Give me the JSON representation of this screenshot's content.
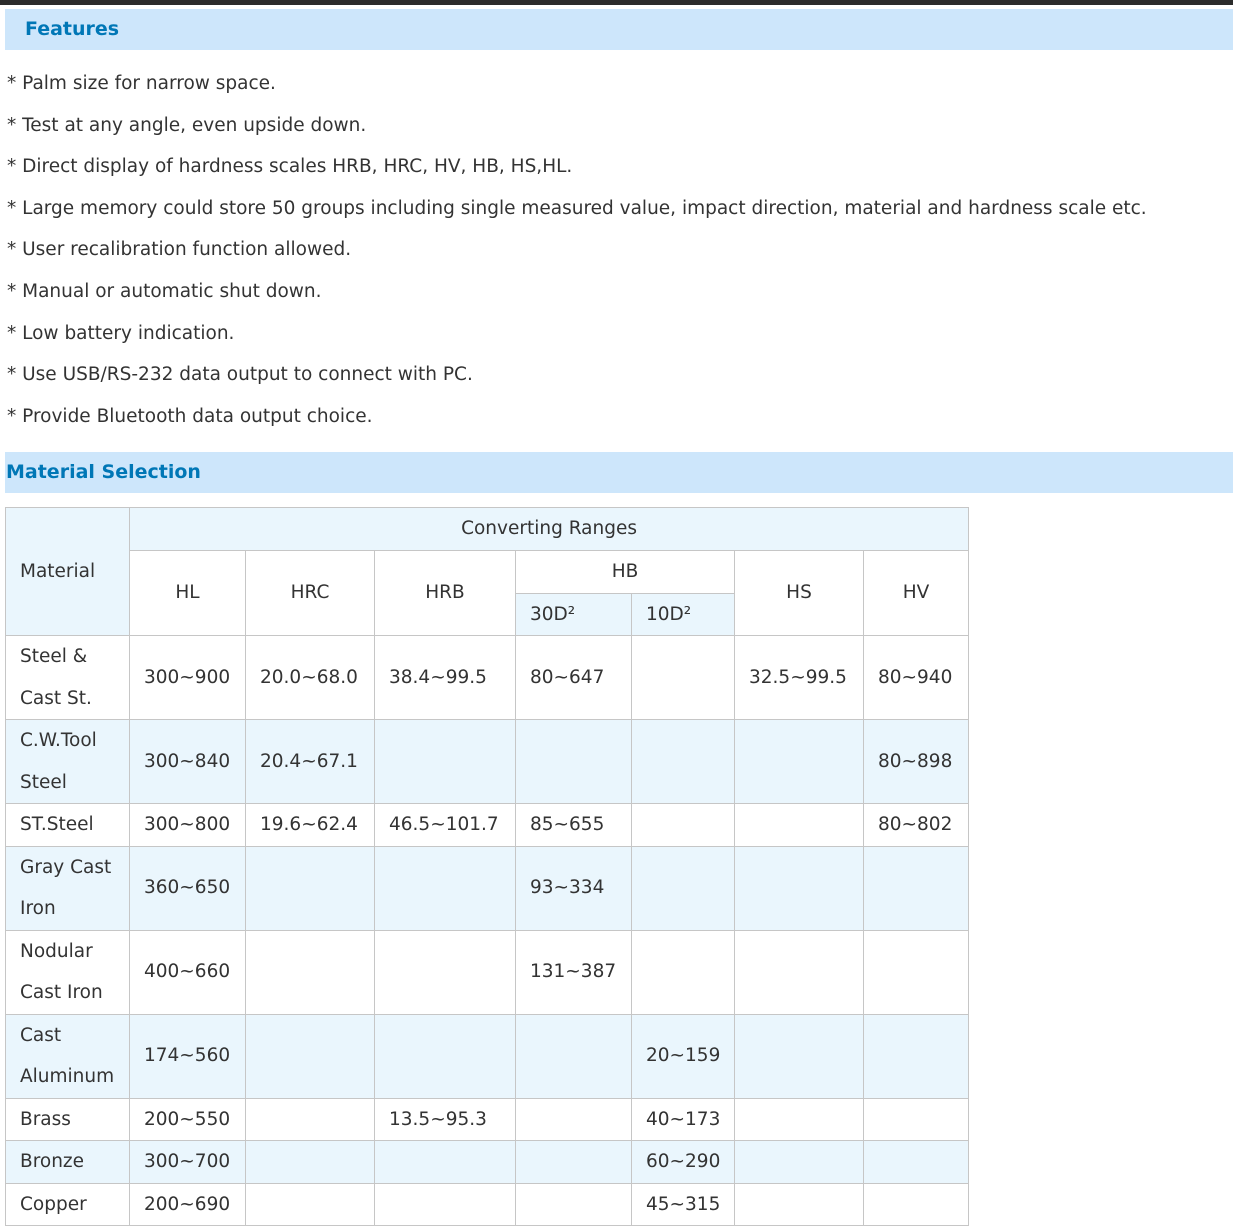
{
  "features": {
    "title": "Features",
    "items": [
      "* Palm size for narrow space.",
      "* Test at any angle, even upside down.",
      "* Direct display of hardness scales HRB, HRC, HV, HB, HS,HL.",
      "* Large memory could store 50 groups including single measured value, impact direction, material and hardness scale etc.",
      "* User recalibration function allowed.",
      "* Manual or automatic shut down.",
      "* Low battery indication.",
      "* Use USB/RS-232 data output to connect with PC.",
      "* Provide Bluetooth data output choice."
    ]
  },
  "material_selection": {
    "title": "Material Selection",
    "header": {
      "material": "Material",
      "converting_ranges": "Converting Ranges",
      "hl": "HL",
      "hrc": "HRC",
      "hrb": "HRB",
      "hb": "HB",
      "hb_30d2": "30D²",
      "hb_10d2": "10D²",
      "hs": "HS",
      "hv": "HV"
    },
    "rows": [
      {
        "material": [
          "Steel &",
          "Cast St."
        ],
        "hl": "300~900",
        "hrc": "20.0~68.0",
        "hrb": "38.4~99.5",
        "hb30": "80~647",
        "hb10": "",
        "hs": "32.5~99.5",
        "hv": "80~940"
      },
      {
        "material": [
          "C.W.Tool",
          "Steel"
        ],
        "hl": "300~840",
        "hrc": "20.4~67.1",
        "hrb": "",
        "hb30": "",
        "hb10": "",
        "hs": "",
        "hv": "80~898"
      },
      {
        "material": [
          "ST.Steel"
        ],
        "hl": "300~800",
        "hrc": "19.6~62.4",
        "hrb": "46.5~101.7",
        "hb30": "85~655",
        "hb10": "",
        "hs": "",
        "hv": "80~802"
      },
      {
        "material": [
          "Gray Cast",
          "Iron"
        ],
        "hl": "360~650",
        "hrc": "",
        "hrb": "",
        "hb30": "93~334",
        "hb10": "",
        "hs": "",
        "hv": ""
      },
      {
        "material": [
          "Nodular",
          "Cast Iron"
        ],
        "hl": "400~660",
        "hrc": "",
        "hrb": "",
        "hb30": "131~387",
        "hb10": "",
        "hs": "",
        "hv": ""
      },
      {
        "material": [
          "Cast",
          "Aluminum"
        ],
        "hl": "174~560",
        "hrc": "",
        "hrb": "",
        "hb30": "",
        "hb10": "20~159",
        "hs": "",
        "hv": ""
      },
      {
        "material": [
          "Brass"
        ],
        "hl": "200~550",
        "hrc": "",
        "hrb": "13.5~95.3",
        "hb30": "",
        "hb10": "40~173",
        "hs": "",
        "hv": ""
      },
      {
        "material": [
          "Bronze"
        ],
        "hl": "300~700",
        "hrc": "",
        "hrb": "",
        "hb30": "",
        "hb10": "60~290",
        "hs": "",
        "hv": ""
      },
      {
        "material": [
          "Copper"
        ],
        "hl": "200~690",
        "hrc": "",
        "hrb": "",
        "hb30": "",
        "hb10": "45~315",
        "hs": "",
        "hv": ""
      }
    ]
  },
  "colors": {
    "header_band": "#cde6fb",
    "header_text": "#0077b6",
    "row_blue": "#eaf6fd",
    "border": "#c6c6c6",
    "body_text": "#333333"
  }
}
